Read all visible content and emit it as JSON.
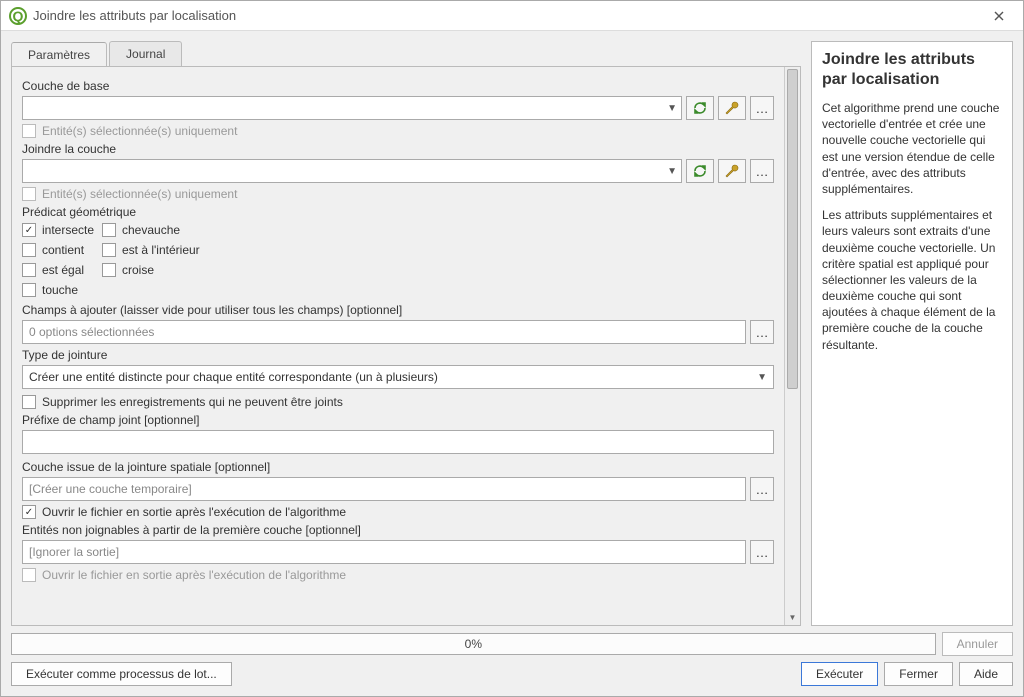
{
  "window": {
    "title": "Joindre les attributs par localisation"
  },
  "tabs": {
    "params": "Paramètres",
    "log": "Journal"
  },
  "form": {
    "base_layer_label": "Couche de base",
    "selected_only": "Entité(s) sélectionnée(s) uniquement",
    "join_layer_label": "Joindre la couche",
    "predicate_label": "Prédicat géométrique",
    "predicates": {
      "intersects": "intersecte",
      "overlaps": "chevauche",
      "contains": "contient",
      "within": "est à l'intérieur",
      "equals": "est égal",
      "crosses": "croise",
      "touches": "touche"
    },
    "fields_label": "Champs à ajouter (laisser vide pour utiliser tous les champs) [optionnel]",
    "fields_placeholder": "0 options sélectionnées",
    "join_type_label": "Type de jointure",
    "join_type_value": "Créer une entité distincte pour chaque entité correspondante (un à plusieurs)",
    "discard_label": "Supprimer les enregistrements qui ne peuvent être joints",
    "prefix_label": "Préfixe de champ joint [optionnel]",
    "output_label": "Couche issue de la jointure spatiale [optionnel]",
    "output_placeholder": "[Créer une couche temporaire]",
    "open_after_label": "Ouvrir le fichier en sortie après l'exécution de l'algorithme",
    "unjoinable_label": "Entités non joignables à partir de la première couche [optionnel]",
    "ignore_placeholder": "[Ignorer la sortie]",
    "open_after_label2": "Ouvrir le fichier en sortie après l'exécution de l'algorithme"
  },
  "help": {
    "title": "Joindre les attributs par localisation",
    "p1": "Cet algorithme prend une couche vectorielle d'entrée et crée une nouvelle couche vectorielle qui est une version étendue de celle d'entrée, avec des attributs supplémentaires.",
    "p2": "Les attributs supplémentaires et leurs valeurs sont extraits d'une deuxième couche vectorielle. Un critère spatial est appliqué pour sélectionner les valeurs de la deuxième couche qui sont ajoutées à chaque élément de la première couche de la couche résultante."
  },
  "progress": {
    "text": "0%"
  },
  "buttons": {
    "cancel": "Annuler",
    "batch": "Exécuter comme processus de lot...",
    "run": "Exécuter",
    "close": "Fermer",
    "help": "Aide"
  }
}
